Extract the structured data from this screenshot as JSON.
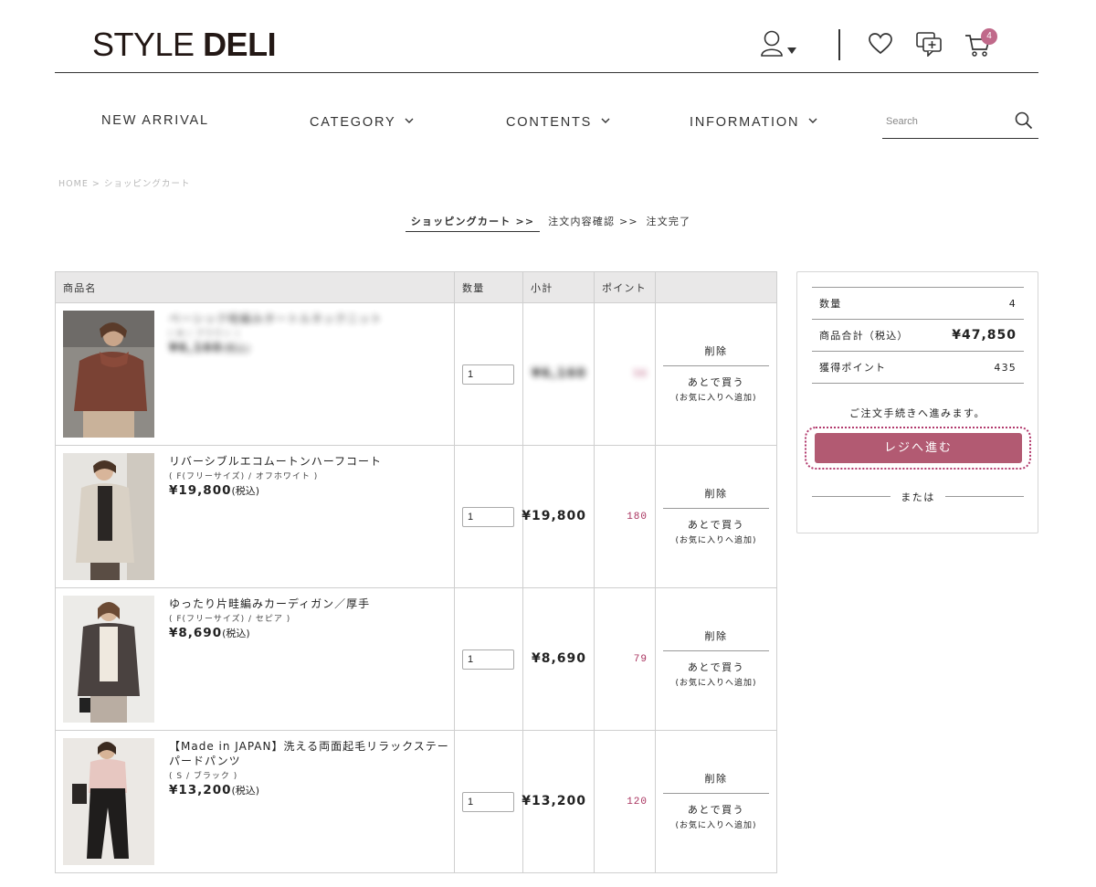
{
  "brand": {
    "light": "STYLE ",
    "bold": "DELI"
  },
  "header": {
    "cart_count": "4"
  },
  "nav": [
    {
      "label": "NEW ARRIVAL"
    },
    {
      "label": "CATEGORY"
    },
    {
      "label": "CONTENTS"
    },
    {
      "label": "INFORMATION"
    }
  ],
  "search": {
    "placeholder": "Search"
  },
  "breadcrumb": "HOME > ショッピングカート",
  "steps": [
    {
      "label": "ショッピングカート >>"
    },
    {
      "label": "注文内容確認 >>"
    },
    {
      "label": "注文完了"
    }
  ],
  "table": {
    "headers": [
      "商品名",
      "数量",
      "小計",
      "ポイント",
      ""
    ],
    "rows": [
      {
        "name": "ベーシック畦編みタートルネックニット",
        "variant": "( M / ブラウン )",
        "price": "¥6,160",
        "tax": "(税込)",
        "qty": "1",
        "subtotal": "¥6,160",
        "points": "56",
        "delete": "削除",
        "later": "あとで買う",
        "fav": "(お気に入りへ追加)"
      },
      {
        "name": "リバーシブルエコムートンハーフコート",
        "variant": "( F(フリーサイズ) / オフホワイト )",
        "price": "¥19,800",
        "tax": "(税込)",
        "qty": "1",
        "subtotal": "¥19,800",
        "points": "180",
        "delete": "削除",
        "later": "あとで買う",
        "fav": "(お気に入りへ追加)"
      },
      {
        "name": "ゆったり片畦編みカーディガン／厚手",
        "variant": "( F(フリーサイズ) / セピア )",
        "price": "¥8,690",
        "tax": "(税込)",
        "qty": "1",
        "subtotal": "¥8,690",
        "points": "79",
        "delete": "削除",
        "later": "あとで買う",
        "fav": "(お気に入りへ追加)"
      },
      {
        "name": "【Made in JAPAN】洗える両面起毛リラックステーパードパンツ",
        "variant": "( S / ブラック )",
        "price": "¥13,200",
        "tax": "(税込)",
        "qty": "1",
        "subtotal": "¥13,200",
        "points": "120",
        "delete": "削除",
        "later": "あとで買う",
        "fav": "(お気に入りへ追加)"
      }
    ]
  },
  "summary": {
    "qty_label": "数量",
    "qty_value": "4",
    "total_label": "商品合計（税込）",
    "total_value": "¥47,850",
    "points_label": "獲得ポイント",
    "points_value": "435",
    "proceed_text": "ご注文手続きへ進みます。",
    "checkout_button": "レジへ進む",
    "or_text": "または"
  },
  "colors": {
    "accent": "#b25a72",
    "badge": "#c0698a",
    "points": "#a8315d"
  },
  "icons": [
    "user-icon",
    "heart-icon",
    "chat-icon",
    "cart-icon",
    "search-icon",
    "chevron-down-icon"
  ]
}
